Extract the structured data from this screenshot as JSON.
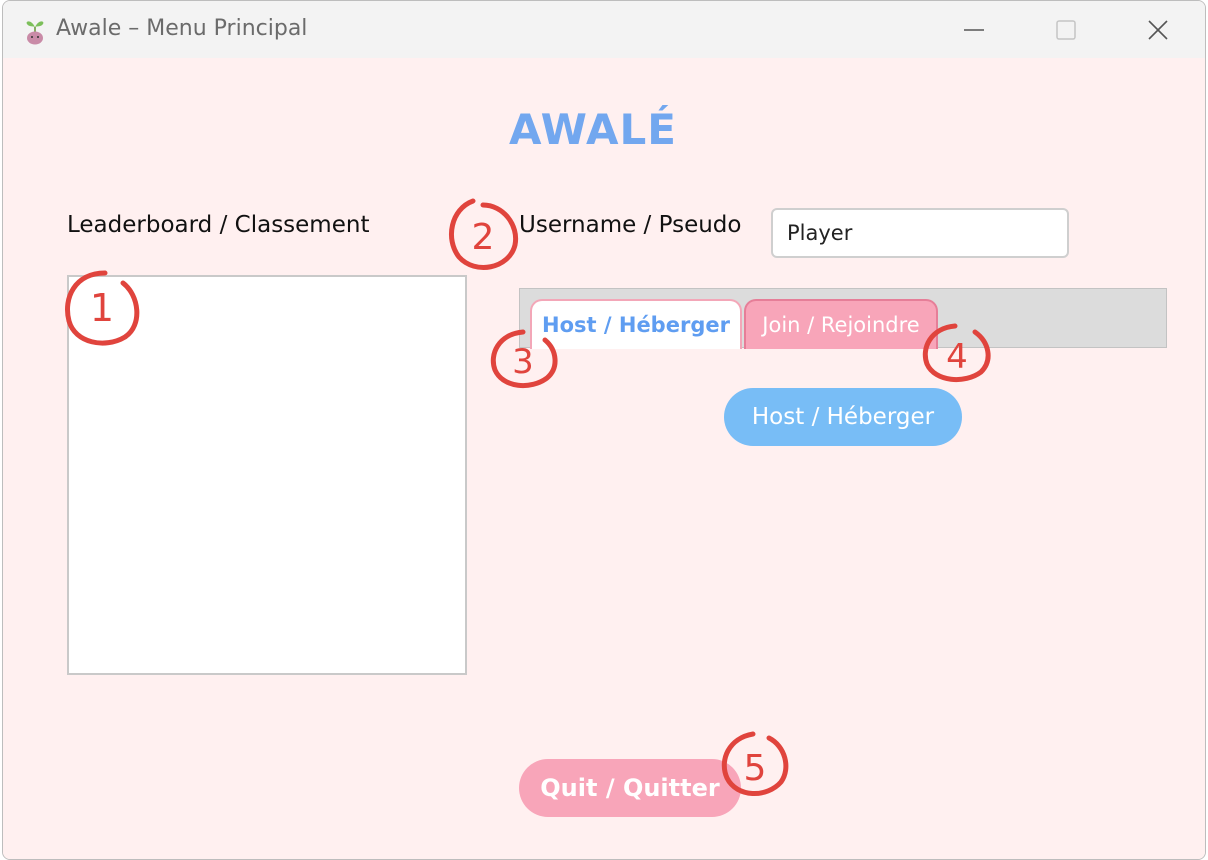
{
  "window": {
    "title": "Awale – Menu Principal",
    "controls": [
      "minimize-icon",
      "maximize-icon",
      "close-icon"
    ]
  },
  "app": {
    "title": "AWALÉ"
  },
  "leaderboard": {
    "label": "Leaderboard / Classement",
    "entries": []
  },
  "username": {
    "label": "Username / Pseudo",
    "value": "Player"
  },
  "tabs": [
    {
      "label": "Host / Héberger",
      "selected": true
    },
    {
      "label": "Join / Rejoindre",
      "selected": false
    }
  ],
  "host_panel": {
    "button_label": "Host / Héberger"
  },
  "quit": {
    "label": "Quit / Quitter"
  },
  "annotations": [
    "1",
    "2",
    "3",
    "4",
    "5"
  ],
  "colors": {
    "background": "#fff0f0",
    "title_blue": "#72a7ef",
    "button_blue": "#78bdf6",
    "button_pink": "#f8a5b9",
    "annotation_red": "#e0443d"
  }
}
